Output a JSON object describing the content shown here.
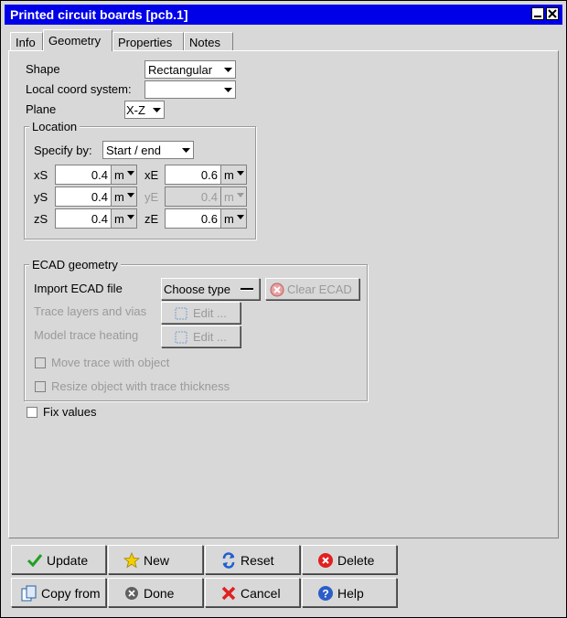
{
  "window": {
    "title": "Printed circuit boards [pcb.1]"
  },
  "tabs": [
    {
      "label": "Info"
    },
    {
      "label": "Geometry"
    },
    {
      "label": "Properties"
    },
    {
      "label": "Notes"
    }
  ],
  "geometry": {
    "shape_label": "Shape",
    "shape_value": "Rectangular",
    "local_coord_label": "Local coord system:",
    "local_coord_value": "",
    "plane_label": "Plane",
    "plane_value": "X-Z"
  },
  "location": {
    "legend": "Location",
    "specify_label": "Specify by:",
    "specify_value": "Start / end",
    "fields": [
      {
        "label": "xS",
        "value": "0.4",
        "unit": "m"
      },
      {
        "label": "yS",
        "value": "0.4",
        "unit": "m"
      },
      {
        "label": "zS",
        "value": "0.4",
        "unit": "m"
      },
      {
        "label": "xE",
        "value": "0.6",
        "unit": "m"
      },
      {
        "label": "yE",
        "value": "0.4",
        "unit": "m"
      },
      {
        "label": "zE",
        "value": "0.6",
        "unit": "m"
      }
    ]
  },
  "ecad": {
    "legend": "ECAD geometry",
    "import_label": "Import ECAD file",
    "choose_type": "Choose type",
    "clear_ecad": "Clear ECAD",
    "trace_layers_label": "Trace layers and vias",
    "model_trace_label": "Model trace heating",
    "edit_label": "Edit ...",
    "move_trace_label": "Move trace with object",
    "resize_object_label": "Resize object with trace thickness"
  },
  "fix_values_label": "Fix values",
  "buttons": {
    "update": "Update",
    "new": "New",
    "reset": "Reset",
    "delete": "Delete",
    "copy_from": "Copy from",
    "done": "Done",
    "cancel": "Cancel",
    "help": "Help"
  },
  "colors": {
    "title_bar": "#0000e8",
    "background": "#d8d8d8",
    "disabled_text": "#9a9a9a"
  }
}
